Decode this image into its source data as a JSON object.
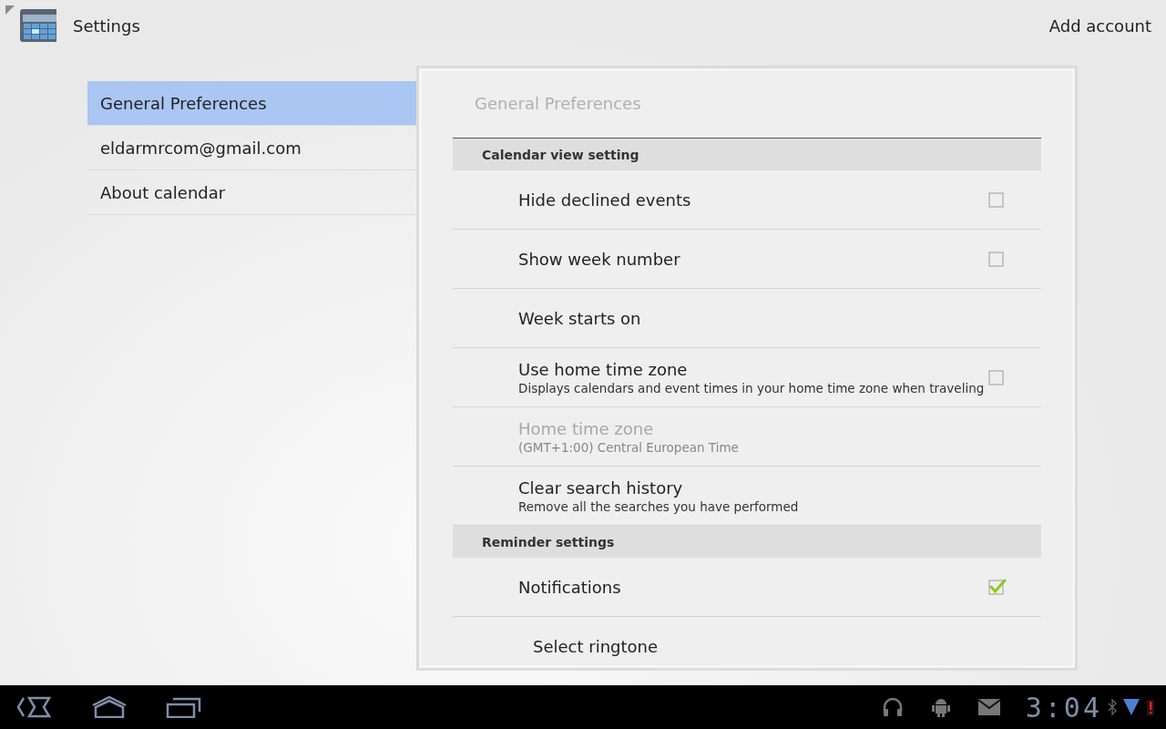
{
  "action_bar": {
    "title": "Settings",
    "action": "Add account"
  },
  "sidebar": {
    "items": [
      {
        "label": "General Preferences",
        "selected": true
      },
      {
        "label": "eldarmrcom@gmail.com",
        "selected": false
      },
      {
        "label": "About calendar",
        "selected": false
      }
    ]
  },
  "panel": {
    "title": "General Preferences",
    "rows": [
      {
        "kind": "header",
        "title": "Calendar view setting"
      },
      {
        "kind": "check",
        "title": "Hide declined events",
        "checked": false,
        "disabled": false
      },
      {
        "kind": "check",
        "title": "Show week number",
        "checked": false,
        "disabled": false
      },
      {
        "kind": "pref",
        "title": "Week starts on",
        "disabled": false
      },
      {
        "kind": "check",
        "title": "Use home time zone",
        "summary": "Displays calendars and event times in your home time zone when traveling",
        "checked": false,
        "disabled": false
      },
      {
        "kind": "pref",
        "title": "Home time zone",
        "summary": "(GMT+1:00) Central European Time",
        "disabled": true
      },
      {
        "kind": "pref",
        "title": "Clear search history",
        "summary": "Remove all the searches you have performed",
        "disabled": false
      },
      {
        "kind": "header",
        "title": "Reminder settings"
      },
      {
        "kind": "check",
        "title": "Notifications",
        "checked": true,
        "disabled": false
      },
      {
        "kind": "subpref",
        "title": "Select ringtone",
        "disabled": false
      }
    ]
  },
  "system_bar": {
    "time": "3:04"
  }
}
